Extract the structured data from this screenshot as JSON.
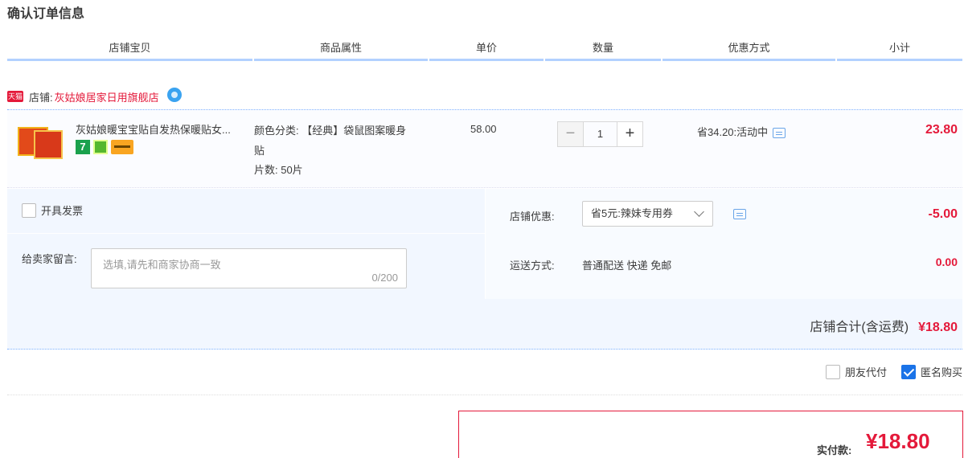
{
  "page": {
    "title": "确认订单信息"
  },
  "columns": [
    "店铺宝贝",
    "商品属性",
    "单价",
    "数量",
    "优惠方式",
    "小计"
  ],
  "shop": {
    "badge": "天猫",
    "label": "店铺:",
    "name": "灰姑娘居家日用旗舰店"
  },
  "item": {
    "title": "灰姑娘暖宝宝贴自发热保暖贴女...",
    "props": [
      "颜色分类: 【经典】袋鼠图案暖身",
      "贴",
      "片数: 50片"
    ],
    "price": "58.00",
    "quantity": "1",
    "minus": "−",
    "plus": "+",
    "discount": "省34.20:活动中",
    "subtotal": "23.80",
    "badge_text": "7"
  },
  "invoice": {
    "label": "开具发票"
  },
  "message": {
    "label": "给卖家留言:",
    "placeholder": "选填,请先和商家协商一致",
    "count": "0/200"
  },
  "store_coupon": {
    "label": "店铺优惠:",
    "value": "省5元:辣妹专用券",
    "amount": "-5.00"
  },
  "shipping": {
    "label": "运送方式:",
    "value": "普通配送 快递 免邮",
    "amount": "0.00"
  },
  "store_total": {
    "label": "店铺合计(含运费)",
    "value": "¥18.80"
  },
  "extras": {
    "friend_pay": "朋友代付",
    "anonymous": "匿名购买",
    "anonymous_checked": true
  },
  "payment": {
    "label": "实付款:",
    "value": "¥18.80"
  },
  "colors": {
    "accent": "#e4193a",
    "header_border": "#b2d1ff",
    "panel_bg": "#f2f7ff"
  }
}
